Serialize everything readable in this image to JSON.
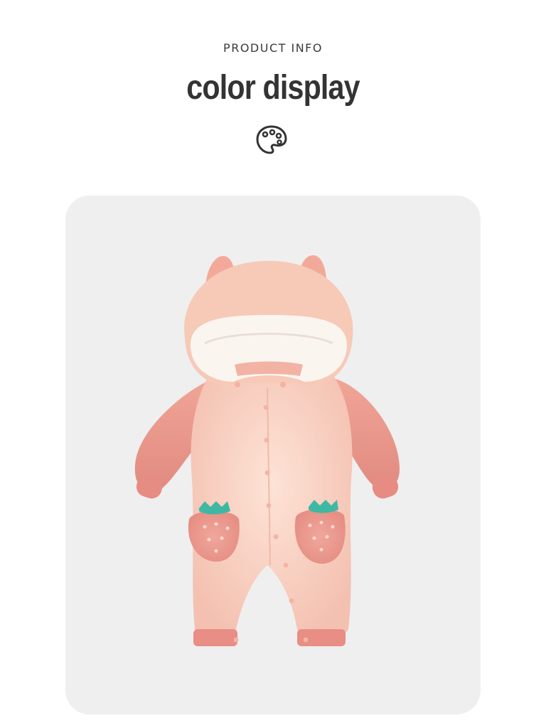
{
  "header": {
    "kicker": "PRODUCT INFO",
    "title": "color display",
    "icon": "palette-icon"
  },
  "product": {
    "image": "baby-romper-photo",
    "colors": {
      "body": "#f8d3c4",
      "sleeves": "#e9968c",
      "hood_lining": "#fbf6f2",
      "leaf": "#3fb8a3",
      "card": "#efefef"
    }
  }
}
